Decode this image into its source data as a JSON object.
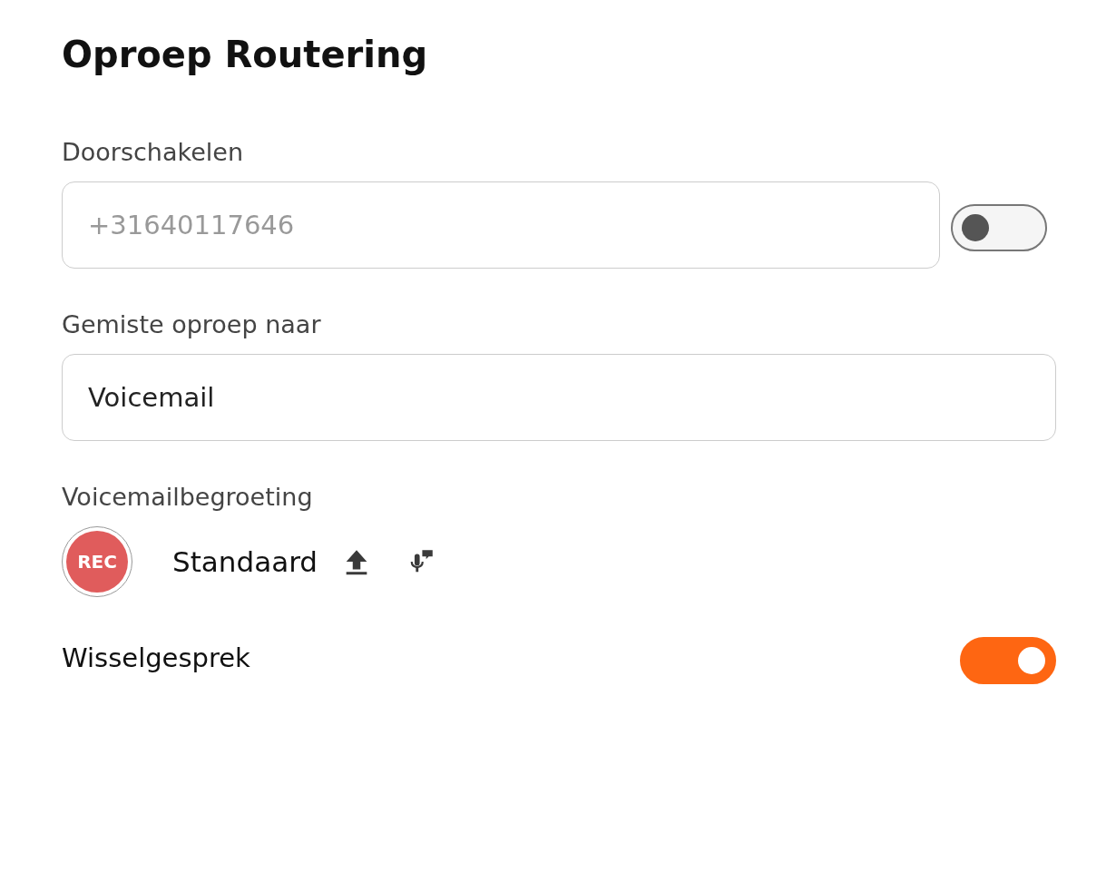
{
  "title": "Oproep Routering",
  "forwarding": {
    "label": "Doorschakelen",
    "placeholder": "+31640117646",
    "on": false
  },
  "missed": {
    "label": "Gemiste oproep naar",
    "value": "Voicemail"
  },
  "greeting": {
    "label": "Voicemailbegroeting",
    "rec": "REC",
    "name": "Standaard"
  },
  "call_waiting": {
    "label": "Wisselgesprek",
    "on": true
  }
}
